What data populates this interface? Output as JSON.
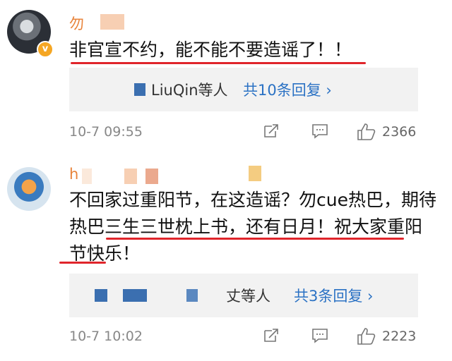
{
  "comments": [
    {
      "username": "勿",
      "text_plain_1": "",
      "text_underlined": "非官宣不约，能不能不要造谣了！！",
      "text_plain_2": "",
      "reply_names": "LiuQin等人",
      "reply_count": "共10条回复 ›",
      "time": "10-7 09:55",
      "likes": "2366"
    },
    {
      "username": "h",
      "text_plain_1": "不回家过重阳节，在这造谣？勿cue热巴，",
      "text_underlined": "期待热巴三生三世枕上书，还有日月！",
      "text_plain_2": "祝大家重阳节快乐！",
      "reply_names": "丈等人",
      "reply_count": "共3条回复 ›",
      "time": "10-7 10:02",
      "likes": "2223"
    }
  ],
  "icons": {
    "share": "share-icon",
    "comment": "comment-icon",
    "like": "thumbs-up-icon",
    "verified": "verified-badge-icon"
  },
  "colors": {
    "username": "#e8833a",
    "link": "#2b72c4",
    "underline": "#e0252b",
    "reply_bg": "#f2f2f2"
  }
}
